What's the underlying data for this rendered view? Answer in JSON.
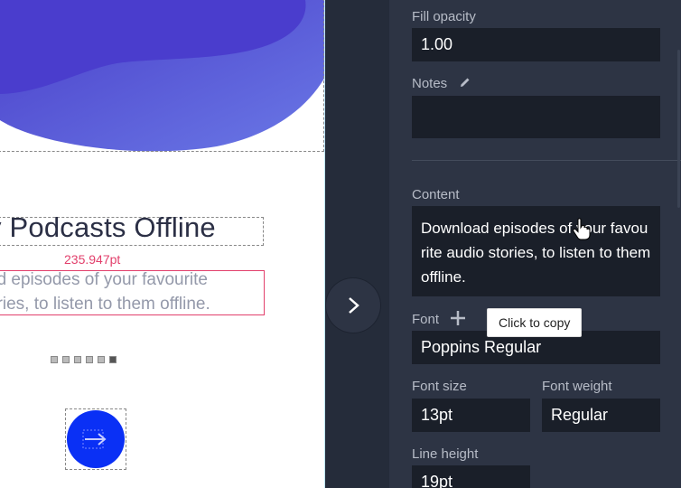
{
  "canvas": {
    "title": "y Podcasts Offline",
    "dimension_label": "235.947pt",
    "body_line1": "ad episodes of your favourite",
    "body_line2": "ories, to listen to them offline."
  },
  "panel": {
    "fill_opacity_label": "Fill opacity",
    "fill_opacity_value": "1.00",
    "notes_label": "Notes",
    "notes_value": "",
    "content_label": "Content",
    "content_value": "Download episodes of your favourite audio stories, to listen to them offline.",
    "font_label": "Font",
    "font_value": "Poppins Regular",
    "font_size_label": "Font size",
    "font_size_value": "13pt",
    "font_weight_label": "Font weight",
    "font_weight_value": "Regular",
    "line_height_label": "Line height",
    "line_height_value": "19pt"
  },
  "tooltip": {
    "text": "Click to copy"
  },
  "icons": {
    "expand": "chevron-right-icon",
    "notes_edit": "pencil-icon",
    "font_add": "plus-icon",
    "cursor": "hand-pointer-icon",
    "button_arrow": "arrow-right-icon"
  },
  "colors": {
    "panel_bg": "#2d3444",
    "field_bg": "#1a1f29",
    "accent_blue": "#0a30f5",
    "dimension_red": "#e2406c",
    "blob_purple": "#5a4bd8"
  }
}
